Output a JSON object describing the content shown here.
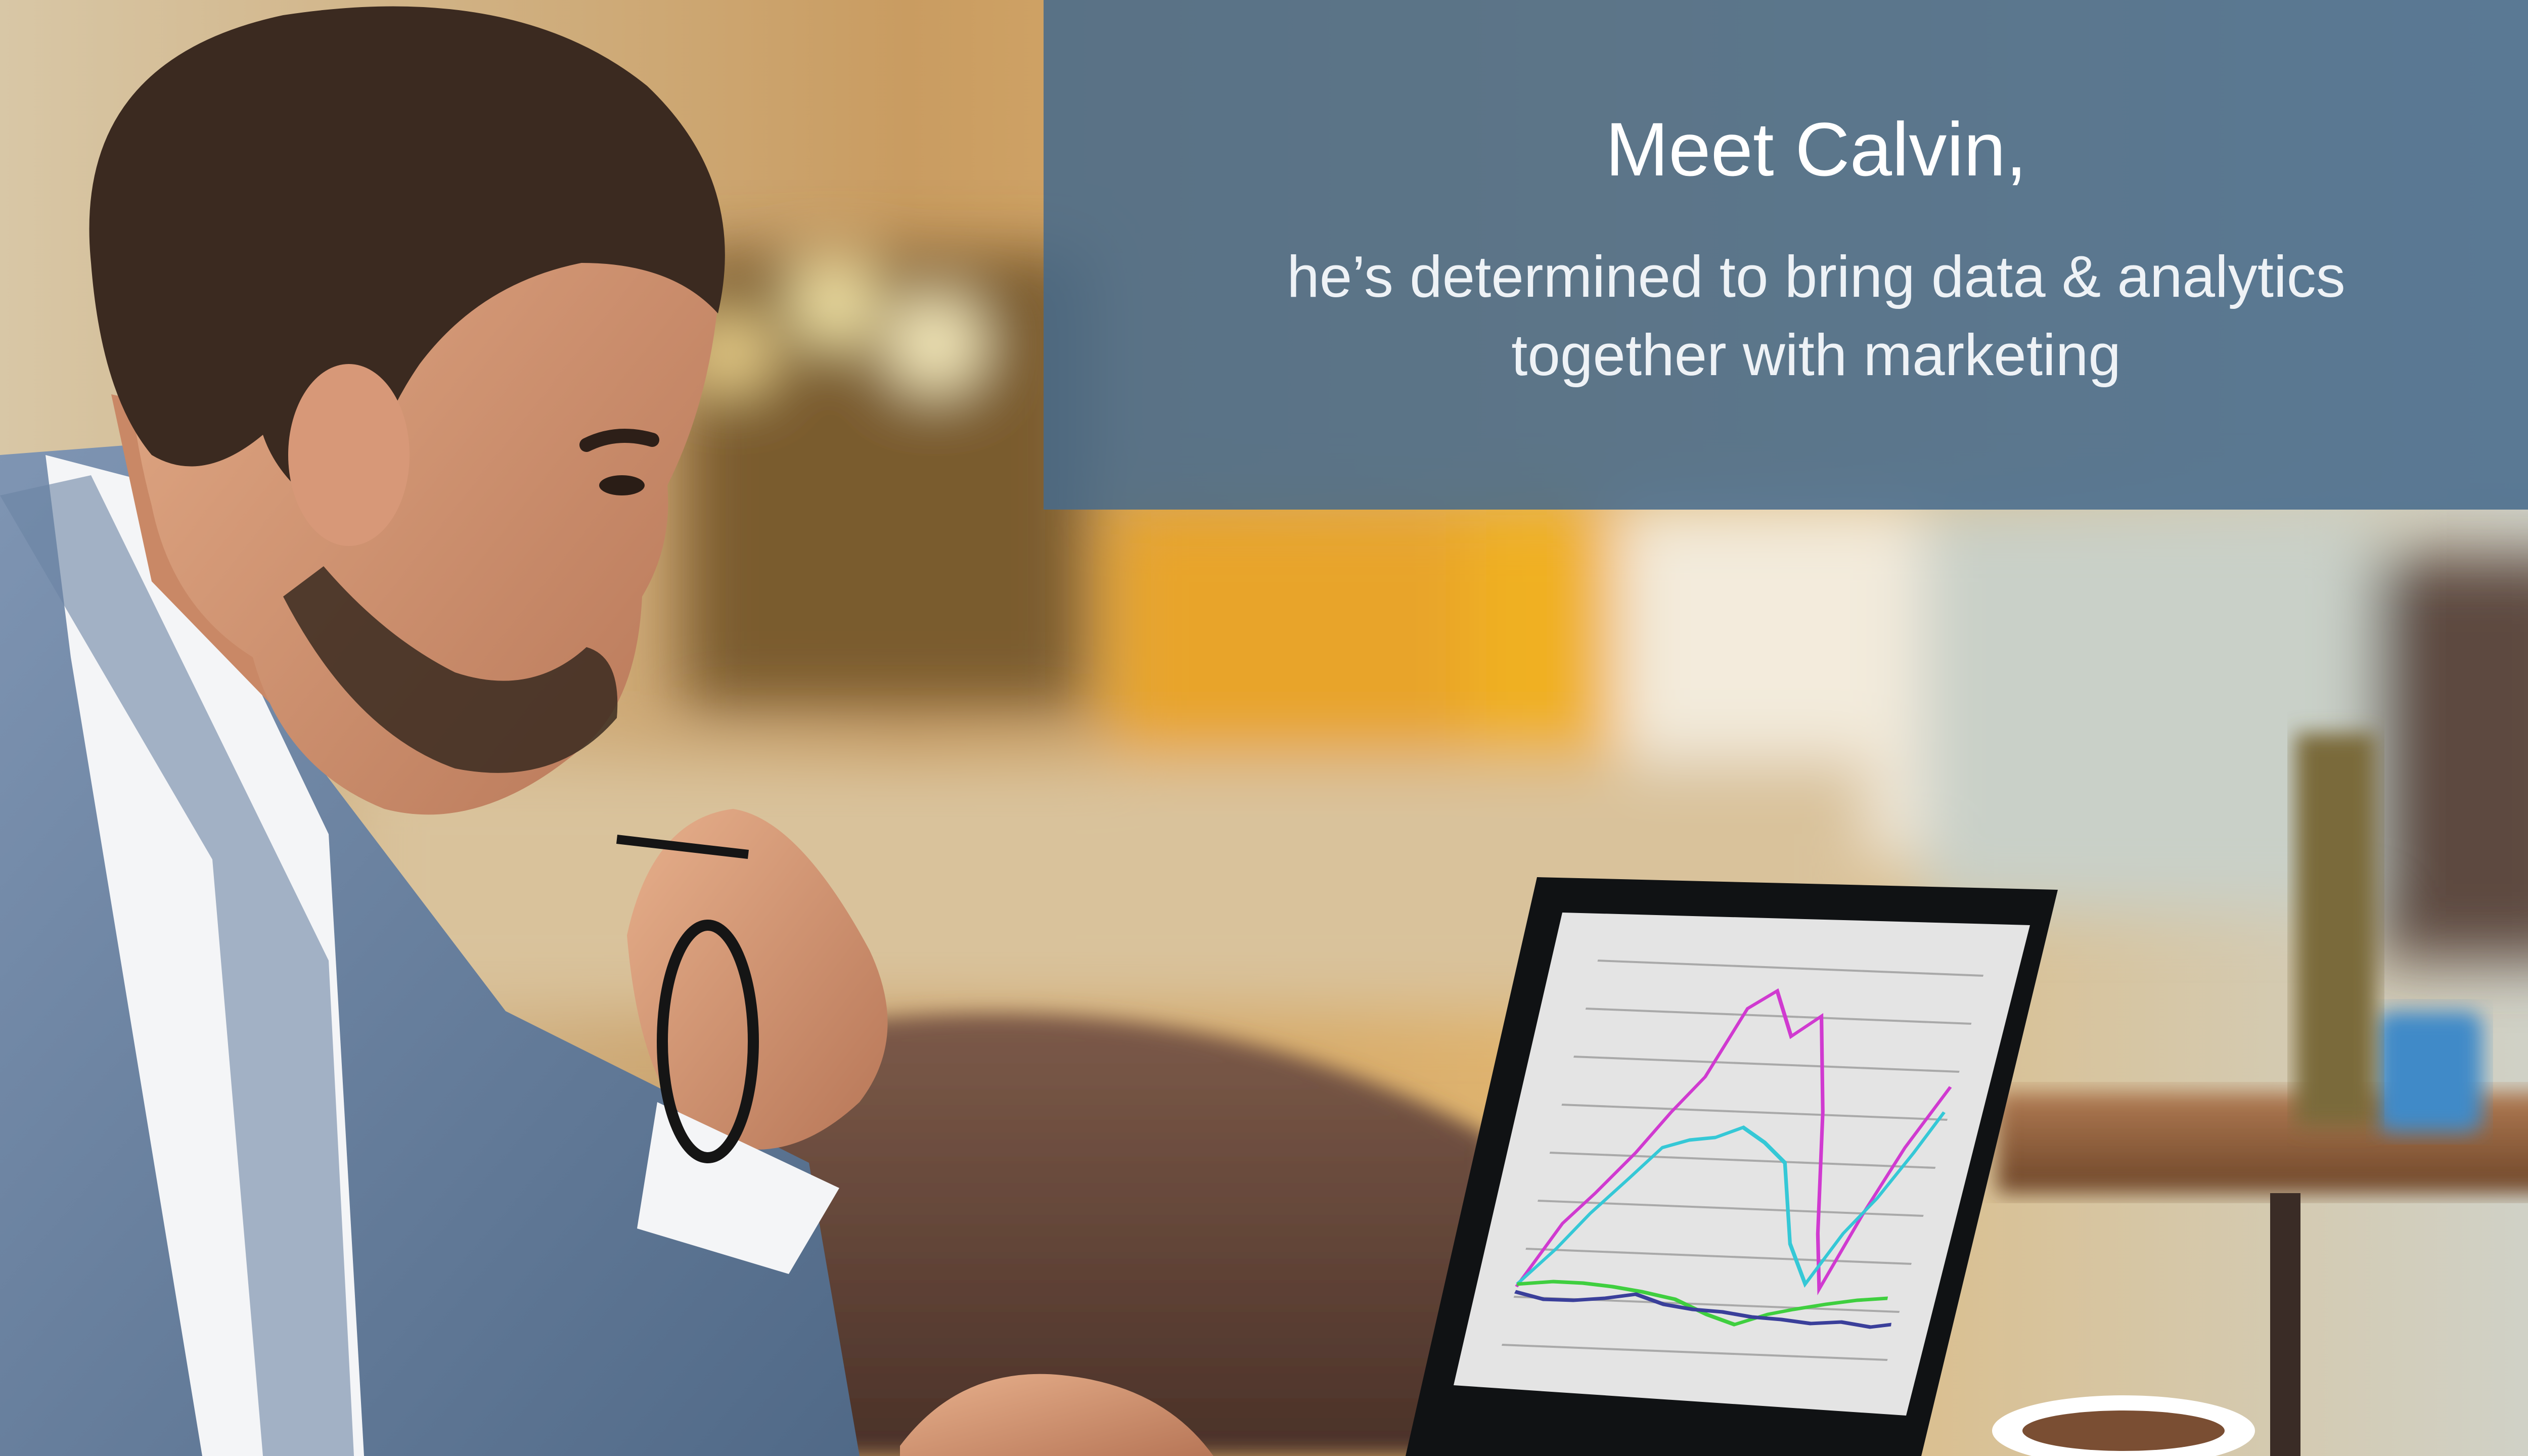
{
  "caption": {
    "headline": "Meet Calvin,",
    "body_line_1": "he’s determined to bring data & analytics",
    "body_line_2": "together with marketing"
  },
  "colors": {
    "panel": "#466a8c",
    "panel_text": "#ffffff",
    "series_magenta": "#d03ad0",
    "series_cyan": "#35c8d6",
    "series_green": "#3fcf3f",
    "series_navy": "#3a3f9a"
  },
  "photo": {
    "subject": "man-in-blue-blazer-holding-glasses",
    "laptop_screen": "line-chart"
  },
  "laptop_chart": {
    "magenta": [
      2,
      18,
      22,
      34,
      40,
      47,
      62,
      68,
      60,
      65,
      55,
      24,
      11,
      32,
      45,
      57
    ],
    "cyan": [
      2,
      11,
      17,
      22,
      29,
      31,
      30,
      34,
      29,
      25,
      9,
      2,
      13,
      19,
      26,
      33
    ],
    "green": [
      4,
      5,
      5,
      4,
      3,
      1,
      -2,
      -4,
      -2,
      1,
      3,
      5,
      4
    ],
    "navy": [
      1,
      -1,
      -1,
      -1,
      0,
      -2,
      -3,
      -3,
      -4,
      -4,
      -5,
      -4,
      -5,
      -5,
      -4
    ]
  }
}
